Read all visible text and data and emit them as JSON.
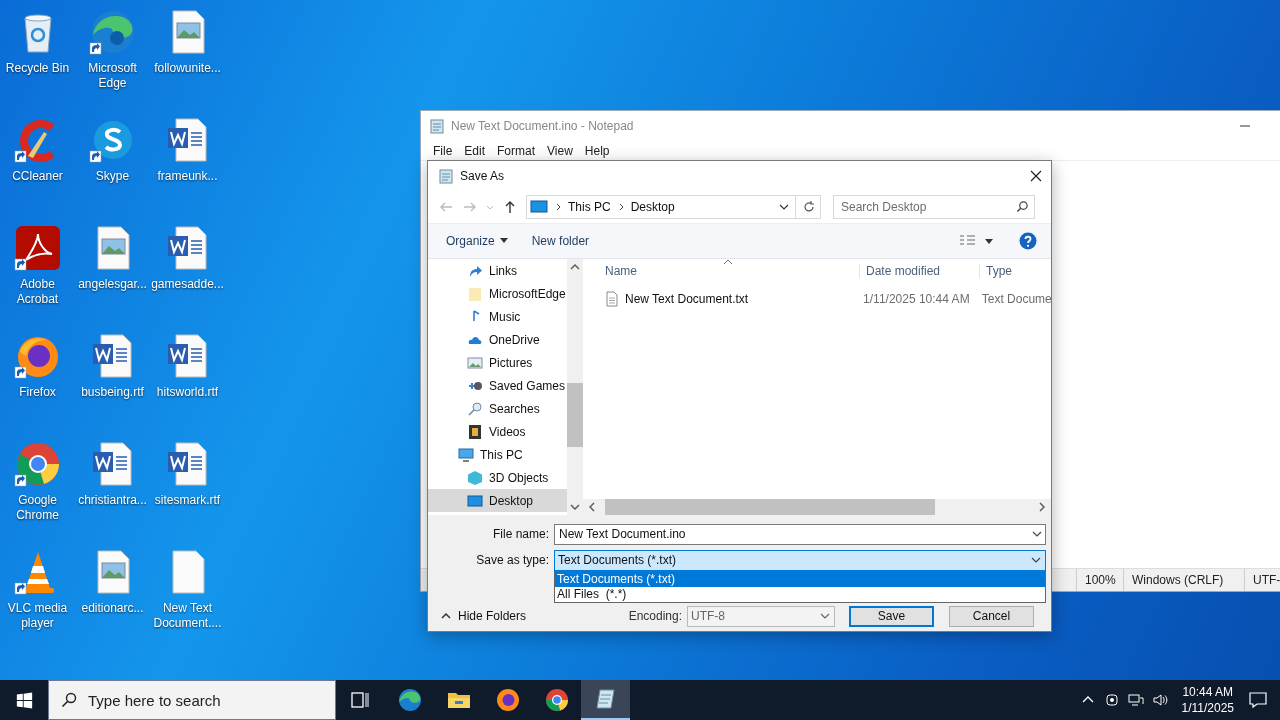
{
  "desktop": {
    "icons": [
      {
        "label": "Recycle Bin",
        "kind": "recycle_bin",
        "shortcut": false
      },
      {
        "label": "CCleaner",
        "kind": "ccleaner",
        "shortcut": true
      },
      {
        "label": "Adobe Acrobat",
        "kind": "acrobat",
        "shortcut": true
      },
      {
        "label": "Firefox",
        "kind": "firefox",
        "shortcut": true
      },
      {
        "label": "Google Chrome",
        "kind": "chrome",
        "shortcut": true
      },
      {
        "label": "VLC media player",
        "kind": "vlc",
        "shortcut": true
      },
      {
        "label": "Microsoft Edge",
        "kind": "edge",
        "shortcut": true
      },
      {
        "label": "Skype",
        "kind": "skype",
        "shortcut": true
      },
      {
        "label": "angelesgar...",
        "kind": "image_file",
        "shortcut": false
      },
      {
        "label": "busbeing.rtf",
        "kind": "word_file",
        "shortcut": false
      },
      {
        "label": "christiantra...",
        "kind": "word_file",
        "shortcut": false
      },
      {
        "label": "editionarc...",
        "kind": "image_file",
        "shortcut": false
      },
      {
        "label": "followunite...",
        "kind": "image_file",
        "shortcut": false
      },
      {
        "label": "frameunk...",
        "kind": "word_file",
        "shortcut": false
      },
      {
        "label": "gamesadde...",
        "kind": "word_file",
        "shortcut": false
      },
      {
        "label": "hitsworld.rtf",
        "kind": "word_file",
        "shortcut": false
      },
      {
        "label": "sitesmark.rtf",
        "kind": "word_file",
        "shortcut": false
      },
      {
        "label": "New Text Document....",
        "kind": "blank_file",
        "shortcut": false
      }
    ]
  },
  "notepad": {
    "title": "New Text Document.ino - Notepad",
    "menu": [
      "File",
      "Edit",
      "Format",
      "View",
      "Help"
    ],
    "status_bar": [
      "100%",
      "Windows (CRLF)",
      "UTF-"
    ]
  },
  "save_as": {
    "title": "Save As",
    "address": [
      "This PC",
      "Desktop"
    ],
    "search": {
      "placeholder": "Search Desktop"
    },
    "toolbar": {
      "organize": "Organize",
      "new_folder": "New folder"
    },
    "tree": [
      {
        "children": [
          {
            "label": "Links",
            "kind": "link",
            "selected": false
          },
          {
            "label": "MicrosoftEdge",
            "kind": "folder",
            "selected": false
          },
          {
            "label": "Music",
            "kind": "music",
            "selected": false
          },
          {
            "label": "OneDrive",
            "kind": "cloud",
            "selected": false
          },
          {
            "label": "Pictures",
            "kind": "pictures",
            "selected": false
          },
          {
            "label": "Saved Games",
            "kind": "games",
            "selected": false
          },
          {
            "label": "Searches",
            "kind": "search",
            "selected": false
          },
          {
            "label": "Videos",
            "kind": "videos",
            "selected": false
          }
        ]
      },
      {
        "label": "This PC",
        "kind": "pc",
        "selected": false,
        "children": [
          {
            "label": "3D Objects",
            "kind": "cube",
            "selected": false
          },
          {
            "label": "Desktop",
            "kind": "desktop",
            "selected": true
          }
        ]
      }
    ],
    "columns": [
      "Name",
      "Date modified",
      "Type"
    ],
    "rows": [
      {
        "name": "New Text Document.txt",
        "date": "1/11/2025 10:44 AM",
        "type": "Text Docume"
      }
    ],
    "file_name": {
      "label": "File name:",
      "value": "New Text Document.ino"
    },
    "save_type": {
      "label": "Save as type:",
      "value": "Text Documents (*.txt)",
      "options": [
        {
          "label": "Text Documents (*.txt)",
          "selected": true
        },
        {
          "label": "All Files  (*.*)",
          "selected": false
        }
      ]
    },
    "hide_folders": "Hide Folders",
    "encoding": {
      "label": "Encoding:",
      "value": "UTF-8"
    },
    "buttons": [
      "Save",
      "Cancel"
    ]
  },
  "taskbar": {
    "search": {
      "placeholder": "Type here to search"
    },
    "apps": [
      {
        "kind": "edge",
        "active": false
      },
      {
        "kind": "explorer",
        "active": false
      },
      {
        "kind": "firefox",
        "active": false
      },
      {
        "kind": "chrome",
        "active": false
      },
      {
        "kind": "notepad",
        "active": true
      }
    ],
    "time": "10:44 AM",
    "date": "1/11/2025"
  }
}
